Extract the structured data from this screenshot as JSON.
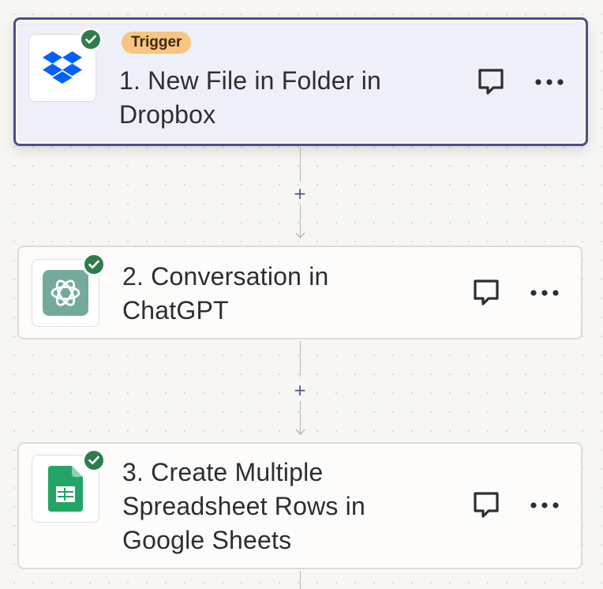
{
  "steps": [
    {
      "number": "1.",
      "title": "1. New File in Folder in Dropbox",
      "title_line1": "1. New File in Folder in",
      "title_line2": "Dropbox",
      "badge": "Trigger",
      "app": "Dropbox",
      "app_icon": "dropbox-icon",
      "status": "complete",
      "selected": true
    },
    {
      "title": "2. Conversation in ChatGPT",
      "title_line1": "2. Conversation in",
      "title_line2": "ChatGPT",
      "app": "ChatGPT",
      "app_icon": "chatgpt-icon",
      "status": "complete",
      "selected": false
    },
    {
      "title": "3. Create Multiple Spreadsheet Rows in Google Sheets",
      "title_line1": "3. Create Multiple",
      "title_line2": "Spreadsheet Rows in",
      "title_line3": "Google Sheets",
      "app": "Google Sheets",
      "app_icon": "google-sheets-icon",
      "status": "complete",
      "selected": false
    }
  ],
  "connector": {
    "add_label": "+"
  },
  "icons": {
    "comment": "comment-icon",
    "more": "more-options-icon",
    "status": "check-icon"
  },
  "colors": {
    "selected_border": "#4d4d8f",
    "selected_background": "#eeeff8",
    "card_background": "#fdfcfa",
    "trigger_badge": "#f6c581",
    "check_badge": "#2f7d4e",
    "dropbox_blue": "#0061fe",
    "chatgpt_green": "#74aa9c",
    "sheets_green": "#23a566",
    "add_step": "#4e4f92"
  }
}
